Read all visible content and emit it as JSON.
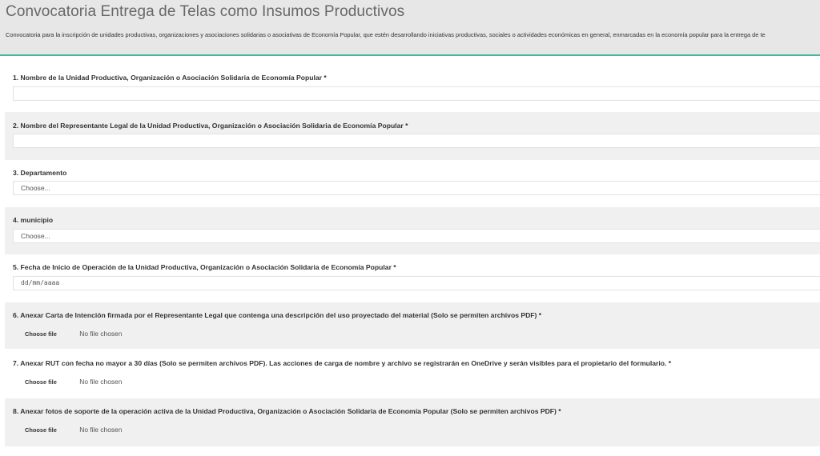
{
  "header": {
    "title": "Convocatoria Entrega de Telas como Insumos Productivos",
    "description": "Convocatoria para la inscripción de unidades productivas, organizaciones y asociaciones solidarias o asociativas de Economía Popular, que estén desarrollando iniciativas productivas, sociales o actividades económicas en general, enmarcadas en la economía popular para la entrega de te"
  },
  "questions": [
    {
      "label": "1. Nombre de la Unidad Productiva, Organización o Asociación Solidaria de Economía Popular *",
      "value": ""
    },
    {
      "label": "2. Nombre del Representante Legal de la Unidad Productiva, Organización o Asociación Solidaria de Economía Popular *",
      "value": ""
    },
    {
      "label": "3. Departamento",
      "placeholder": "Choose..."
    },
    {
      "label": "4. municipio",
      "placeholder": "Choose..."
    },
    {
      "label": "5. Fecha de Inicio de Operación de la Unidad Productiva, Organización o Asociación Solidaria de Economía Popular *",
      "placeholder": "dd/mm/aaaa"
    },
    {
      "label": "6. Anexar Carta de Intención firmada por el Representante Legal que contenga una descripción del uso proyectado del material (Solo se permiten archivos PDF) *",
      "button": "Choose file",
      "status": "No file chosen"
    },
    {
      "label": "7. Anexar RUT con fecha no mayor a 30 días (Solo se permiten archivos PDF). Las acciones de carga de nombre y archivo se registrarán en OneDrive y serán visibles para el propietario del formulario. *",
      "button": "Choose file",
      "status": "No file chosen"
    },
    {
      "label": "8. Anexar fotos de soporte de la operación activa de la Unidad Productiva, Organización o Asociación Solidaria de Economía Popular (Solo se permiten archivos PDF) *",
      "button": "Choose file",
      "status": "No file chosen"
    }
  ]
}
